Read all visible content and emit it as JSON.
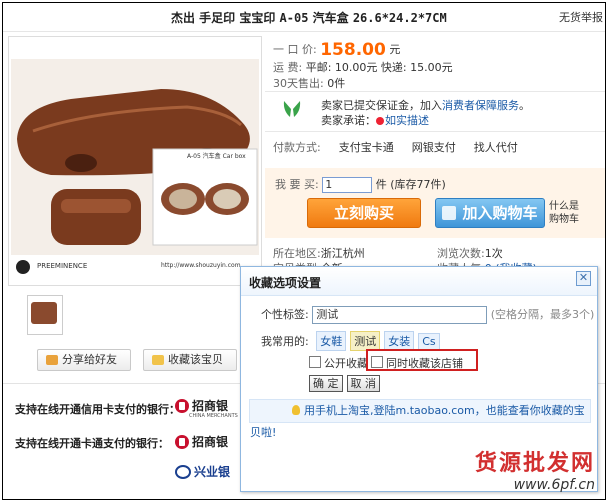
{
  "title": {
    "main_text": "杰出 手足印 宝宝印 ",
    "model_text": "A-05",
    "sub_text": " 汽车盒 ",
    "size_text": "26.6*24.2*7CM",
    "no_free": "无货举报"
  },
  "price": {
    "label": "一 口 价:",
    "value": "158.00",
    "unit": "元",
    "shipping_label": "运       费:",
    "shipping_value": "平邮: 10.00元 快递: 15.00元",
    "sold_label": "30天售出:",
    "sold_value": "0件"
  },
  "guarantee": {
    "line1_prefix": "卖家已提交保证金，加入",
    "line1_link": "消费者保障服务",
    "line1_suffix": "。",
    "line2_prefix": "卖家承诺：",
    "line2_link": "如实描述"
  },
  "payment": {
    "label": "付款方式:",
    "methods": [
      "支付宝卡通",
      "网银支付",
      "找人代付"
    ]
  },
  "purchase": {
    "qty_label": "我 要 买:",
    "qty_value": "1",
    "stock_text": "件 (库存77件)",
    "buy_now": "立刻购买",
    "add_cart": "加入购物车",
    "what_is_line1": "什么是",
    "what_is_line2": "购物车"
  },
  "details": {
    "location_label": "所在地区:",
    "location_value": "浙江杭州",
    "views_label": "浏览次数:",
    "views_value": "1次",
    "category_label": "宝贝类型:",
    "category_value": "全新",
    "fav_label": "收藏人气:",
    "fav_value": "0 (我收藏)"
  },
  "photo": {
    "model_caption": "A-05   汽车盒 Car box",
    "brand": "PREEMINENCE",
    "url": "http://www.shouzuyin.com"
  },
  "actions": {
    "share": "分享给好友",
    "favorite": "收藏该宝贝"
  },
  "banks": {
    "credit_label": "支持在线开通信用卡支付的银行：",
    "debit_label": "支持在线开通卡通支付的银行：",
    "cmb_name": "招商银",
    "cmb_small": "CHINA MERCHANTS",
    "cib_name": "兴业银"
  },
  "dialog": {
    "title": "收藏选项设置",
    "tag_label": "个性标签:",
    "tag_value": "测试",
    "tag_hint": "(空格分隔，最多3个)",
    "common_label": "我常用的:",
    "chips": [
      "女鞋",
      "测试",
      "女装",
      "Cs"
    ],
    "public_label": "公开收藏",
    "store_label": "同时收藏该店铺",
    "confirm": "确 定",
    "cancel": "取 消",
    "tip": "用手机上淘宝,登陆m.taobao.com，也能查看你收藏的宝贝啦!"
  },
  "watermark": {
    "line1": "货源批发网",
    "line2": "www.6pf.cn"
  },
  "colors": {
    "price": "#ff6600",
    "link": "#1a5aa6",
    "buy_button": "#f07a10",
    "cart_button": "#3f95d8",
    "highlight_border": "#d02020"
  }
}
